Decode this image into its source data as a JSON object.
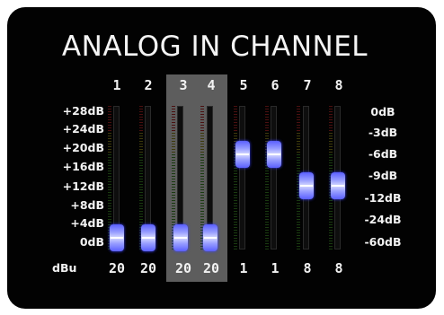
{
  "title": "ANALOG IN CHANNEL",
  "channels": [
    {
      "number": "1",
      "gain": "20",
      "fader_level": 0.04,
      "highlighted": false
    },
    {
      "number": "2",
      "gain": "20",
      "fader_level": 0.04,
      "highlighted": false
    },
    {
      "number": "3",
      "gain": "20",
      "fader_level": 0.04,
      "highlighted": true
    },
    {
      "number": "4",
      "gain": "20",
      "fader_level": 0.04,
      "highlighted": true
    },
    {
      "number": "5",
      "gain": "1",
      "fader_level": 0.7,
      "highlighted": false
    },
    {
      "number": "6",
      "gain": "1",
      "fader_level": 0.7,
      "highlighted": false
    },
    {
      "number": "7",
      "gain": "8",
      "fader_level": 0.45,
      "highlighted": false
    },
    {
      "number": "8",
      "gain": "8",
      "fader_level": 0.45,
      "highlighted": false
    }
  ],
  "scale_left": [
    "+28dB",
    "+24dB",
    "+20dB",
    "+16dB",
    "+12dB",
    "+8dB",
    "+4dB",
    "0dB"
  ],
  "scale_right": [
    "0dB",
    "-3dB",
    "-6dB",
    "-9dB",
    "-12dB",
    "-24dB",
    "-60dB"
  ],
  "gain_unit": "dBu",
  "colors": {
    "background": "#020202",
    "highlight": "#5d5d5d",
    "fader_knob": "#8a90ff",
    "text": "#f2f2f2"
  }
}
